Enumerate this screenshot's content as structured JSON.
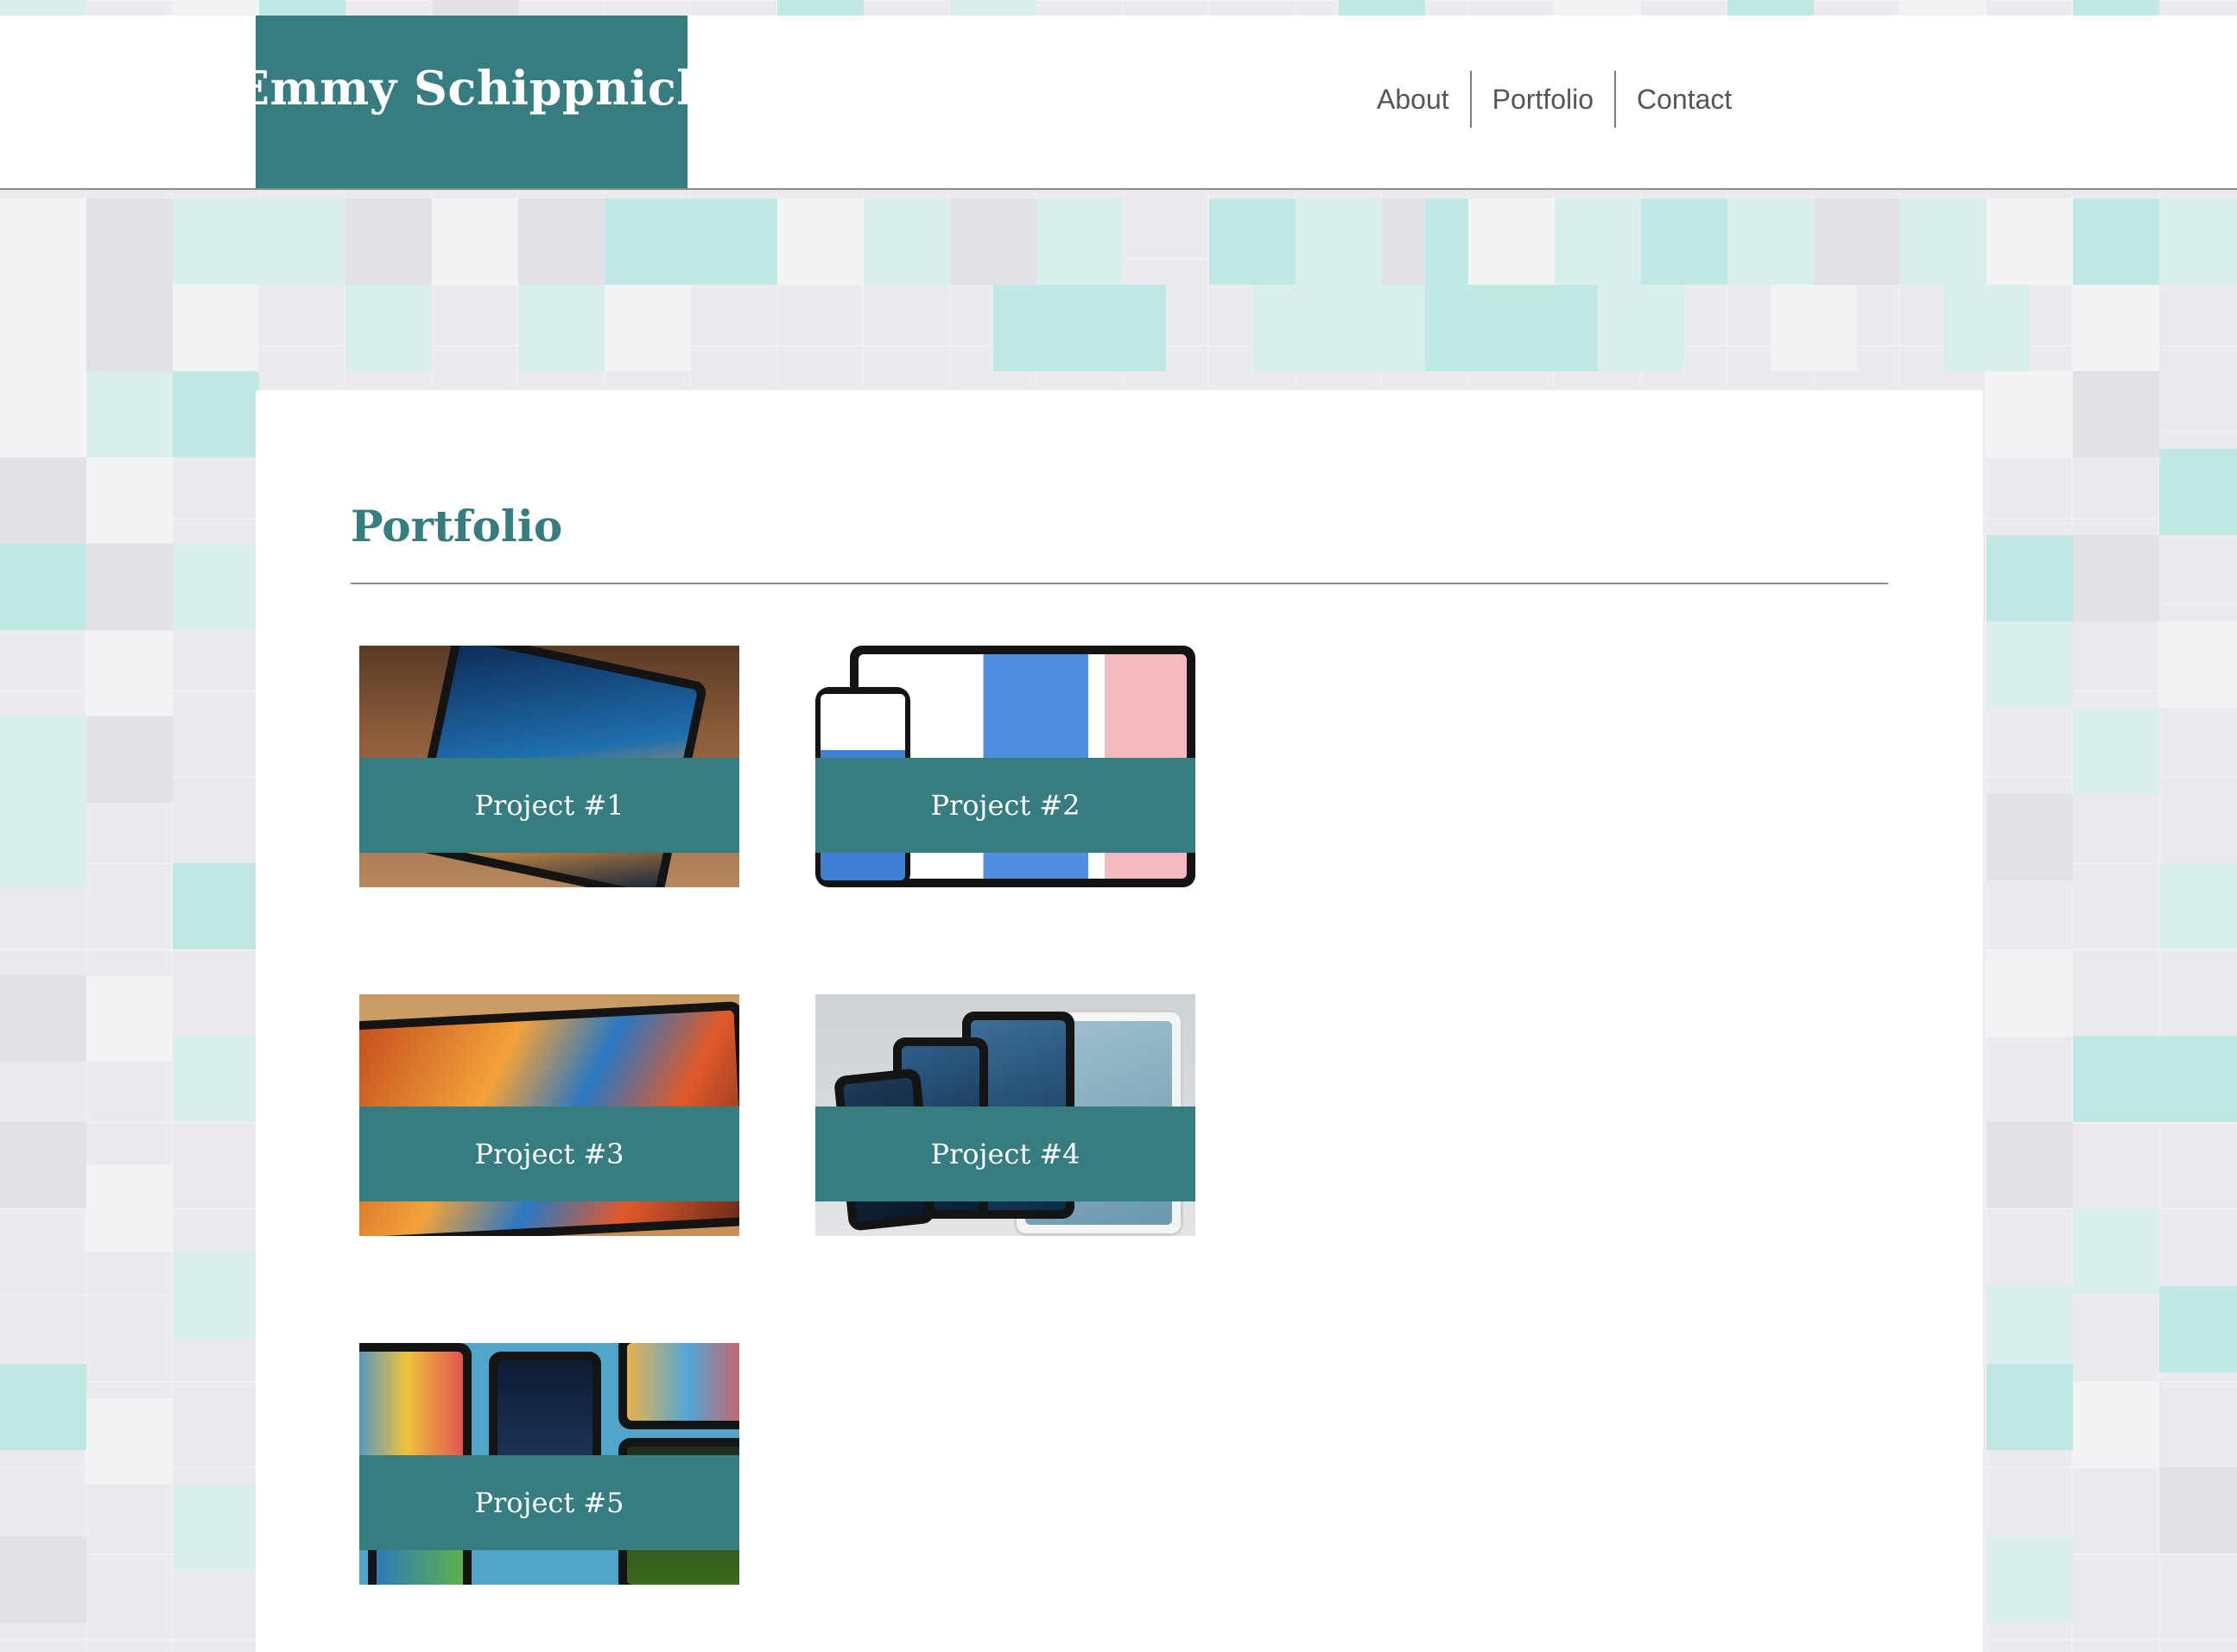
{
  "site": {
    "brand": "Emmy Schippnick"
  },
  "nav": {
    "items": [
      "About",
      "Portfolio",
      "Contact"
    ]
  },
  "main": {
    "title": "Portfolio",
    "projects": [
      {
        "label": "Project #1"
      },
      {
        "label": "Project #2"
      },
      {
        "label": "Project #3"
      },
      {
        "label": "Project #4"
      },
      {
        "label": "Project #5"
      }
    ]
  },
  "colors": {
    "accent": "#377c7f",
    "text": "#555555",
    "rule": "#8b8b8b",
    "background": "#eceaee"
  },
  "icons": {
    "project-1-thumbnail": "tablet-on-wood-image",
    "project-2-thumbnail": "ipad-and-iphone-app-store-image",
    "project-3-thumbnail": "tablet-drawing-app-image",
    "project-4-thumbnail": "ipad-family-image",
    "project-5-thumbnail": "kids-apps-on-tablets-image"
  }
}
